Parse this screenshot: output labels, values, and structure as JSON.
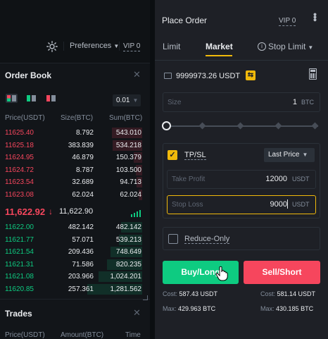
{
  "toolbar": {
    "preferences_label": "Preferences",
    "vip_label": "VIP 0"
  },
  "order_book": {
    "title": "Order Book",
    "precision": "0.01",
    "headers": {
      "price": "Price(USDT)",
      "size": "Size(BTC)",
      "sum": "Sum(BTC)"
    },
    "asks": [
      {
        "price": "11625.40",
        "size": "8.792",
        "sum": "543.010",
        "depth": 0.55
      },
      {
        "price": "11625.18",
        "size": "383.839",
        "sum": "534.218",
        "depth": 0.54
      },
      {
        "price": "11624.95",
        "size": "46.879",
        "sum": "150.379",
        "depth": 0.16
      },
      {
        "price": "11624.72",
        "size": "8.787",
        "sum": "103.500",
        "depth": 0.11
      },
      {
        "price": "11623.54",
        "size": "32.689",
        "sum": "94.713",
        "depth": 0.1
      },
      {
        "price": "11623.08",
        "size": "62.024",
        "sum": "62.024",
        "depth": 0.07
      }
    ],
    "last_price": "11,622.92",
    "mark_price": "11,622.90",
    "bids": [
      {
        "price": "11622.00",
        "size": "482.142",
        "sum": "482.142",
        "depth": 0.38
      },
      {
        "price": "11621.77",
        "size": "57.071",
        "sum": "539.213",
        "depth": 0.42
      },
      {
        "price": "11621.54",
        "size": "209.436",
        "sum": "748.649",
        "depth": 0.58
      },
      {
        "price": "11621.31",
        "size": "71.586",
        "sum": "820.235",
        "depth": 0.64
      },
      {
        "price": "11621.08",
        "size": "203.966",
        "sum": "1,024.201",
        "depth": 0.8
      },
      {
        "price": "11620.85",
        "size": "257.361",
        "sum": "1,281.562",
        "depth": 1.0
      }
    ]
  },
  "trades": {
    "title": "Trades",
    "headers": {
      "price": "Price(USDT)",
      "amount": "Amount(BTC)",
      "time": "Time"
    }
  },
  "order_panel": {
    "title": "Place Order",
    "vip_label": "VIP 0",
    "tabs": {
      "limit": "Limit",
      "market": "Market",
      "stop_limit": "Stop Limit"
    },
    "balance": "9999973.26 USDT",
    "size": {
      "label": "Size",
      "value": "1",
      "unit": "BTC"
    },
    "tpsl": {
      "label": "TP/SL",
      "trigger": "Last Price"
    },
    "take_profit": {
      "placeholder": "Take Profit",
      "value": "12000",
      "unit": "USDT"
    },
    "stop_loss": {
      "placeholder": "Stop Loss",
      "value": "9000",
      "unit": "USDT"
    },
    "reduce_only_label": "Reduce-Only",
    "buy_label": "Buy/Long",
    "sell_label": "Sell/Short",
    "buy_cost_label": "Cost:",
    "buy_cost": "587.43 USDT",
    "buy_max_label": "Max:",
    "buy_max": "429.963 BTC",
    "sell_cost_label": "Cost:",
    "sell_cost": "581.14 USDT",
    "sell_max_label": "Max:",
    "sell_max": "430.185 BTC"
  },
  "colors": {
    "up": "#0ecb81",
    "down": "#f6465d",
    "accent": "#f0b90b"
  }
}
